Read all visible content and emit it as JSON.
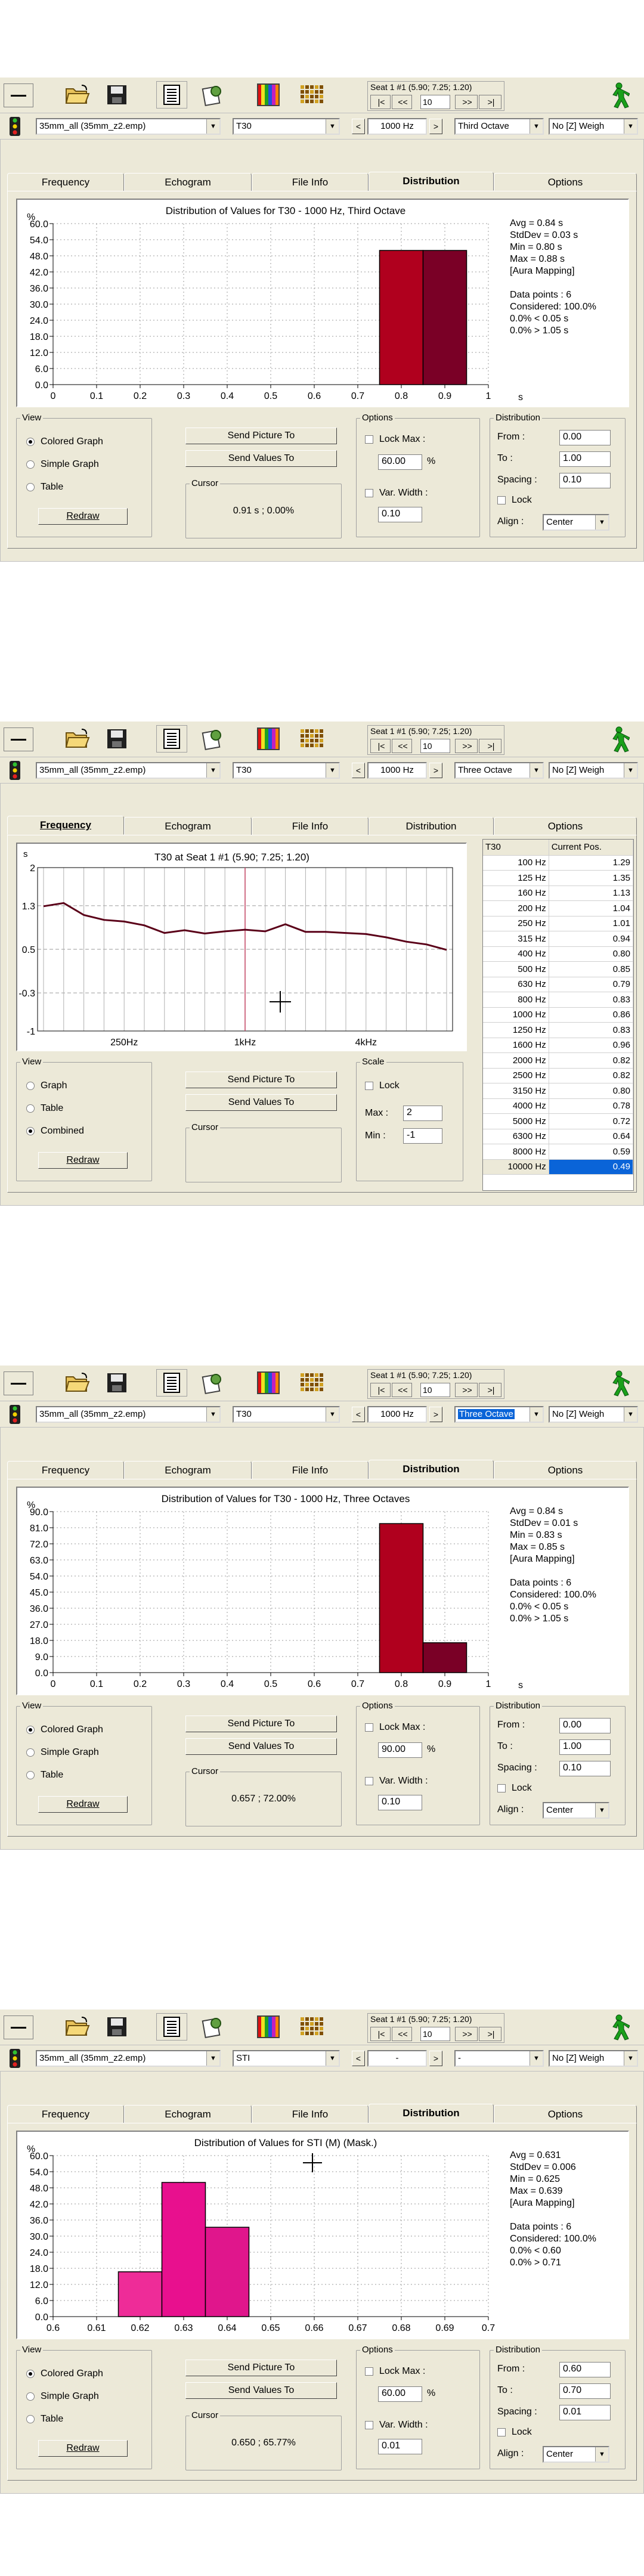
{
  "toolbar": {
    "seat_label": "Seat 1 #1",
    "seat_coords": "(5.90; 7.25; 1.20)",
    "nav_first": "|<",
    "nav_prev": "<<",
    "nav_prev_one": "<",
    "nav_value": "10",
    "nav_next": ">>",
    "nav_last": ">|"
  },
  "tab_labels": [
    "Frequency",
    "Echogram",
    "File Info",
    "Distribution",
    "Options"
  ],
  "common": {
    "view_title": "View",
    "send_picture": "Send Picture To",
    "send_values": "Send Values To",
    "cursor_title": "Cursor",
    "options_title": "Options",
    "distribution_title": "Distribution",
    "lock_max": "Lock Max :",
    "var_width": "Var. Width :",
    "from": "From :",
    "to": "To :",
    "spacing": "Spacing :",
    "lock": "Lock",
    "align": "Align :",
    "redraw": "Redraw",
    "colored_graph": "Colored Graph",
    "simple_graph": "Simple Graph",
    "table": "Table",
    "graph": "Graph",
    "combined": "Combined",
    "scale_title": "Scale",
    "max": "Max :",
    "min": "Min :",
    "percent": "%",
    "unit_s": "s"
  },
  "panels": [
    {
      "file": "35mm_all (35mm_z2.emp)",
      "param": "T30",
      "freq": "1000 Hz",
      "band": "Third Octave",
      "weight": "No [Z] Weigh",
      "active_tab": "Distribution",
      "title": "Distribution of Values for T30 - 1000 Hz, Third Octave",
      "y_ticks": [
        "60.0",
        "54.0",
        "48.0",
        "42.0",
        "36.0",
        "30.0",
        "24.0",
        "18.0",
        "12.0",
        "6.0",
        "0.0"
      ],
      "x_ticks": [
        "0",
        "0.1",
        "0.2",
        "0.3",
        "0.4",
        "0.5",
        "0.6",
        "0.7",
        "0.8",
        "0.9",
        "1"
      ],
      "stats": [
        "Avg = 0.84 s",
        "StdDev = 0.03 s",
        "Min = 0.80 s",
        "Max = 0.88 s",
        "[Aura Mapping]",
        "",
        "Data points : 6",
        "Considered: 100.0%",
        "0.0% < 0.05 s",
        "0.0% > 1.05 s"
      ],
      "cursor_value": "0.91 s ; 0.00%",
      "lock_max_value": "60.00",
      "var_width_value": "0.10",
      "from_value": "0.00",
      "to_value": "1.00",
      "spacing_value": "0.10",
      "align_value": "Center",
      "view_selected": "Colored Graph",
      "chart_data": {
        "type": "bar",
        "title": "Distribution of Values for T30 - 1000 Hz, Third Octave",
        "xlabel": "s",
        "ylabel": "%",
        "ylim": [
          0,
          60
        ],
        "xlim": [
          0,
          1
        ],
        "bin_width": 0.1,
        "bins": [
          {
            "x": 0.8,
            "value": 50.0,
            "color": "#B0001E"
          },
          {
            "x": 0.9,
            "value": 50.0,
            "color": "#7A0026"
          }
        ],
        "grid": true
      }
    },
    {
      "file": "35mm_all (35mm_z2.emp)",
      "param": "T30",
      "freq": "1000 Hz",
      "band": "Three Octave",
      "weight": "No [Z] Weigh",
      "active_tab": "Frequency",
      "title": "T30 at Seat 1 #1 (5.90; 7.25; 1.20)",
      "y_ticks": [
        "2",
        "1.3",
        "0.5",
        "-0.3",
        "-1"
      ],
      "y_unit": "s",
      "x_ticks": [
        "250Hz",
        "1kHz",
        "4kHz"
      ],
      "scale_lock": "Lock",
      "max_value": "2",
      "min_value": "-1",
      "view_selected": "Combined",
      "table_headers": [
        "T30",
        "Current Pos."
      ],
      "table_rows": [
        [
          "100 Hz",
          "1.29"
        ],
        [
          "125 Hz",
          "1.35"
        ],
        [
          "160 Hz",
          "1.13"
        ],
        [
          "200 Hz",
          "1.04"
        ],
        [
          "250 Hz",
          "1.01"
        ],
        [
          "315 Hz",
          "0.94"
        ],
        [
          "400 Hz",
          "0.80"
        ],
        [
          "500 Hz",
          "0.85"
        ],
        [
          "630 Hz",
          "0.79"
        ],
        [
          "800 Hz",
          "0.83"
        ],
        [
          "1000 Hz",
          "0.86"
        ],
        [
          "1250 Hz",
          "0.83"
        ],
        [
          "1600 Hz",
          "0.96"
        ],
        [
          "2000 Hz",
          "0.82"
        ],
        [
          "2500 Hz",
          "0.82"
        ],
        [
          "3150 Hz",
          "0.80"
        ],
        [
          "4000 Hz",
          "0.78"
        ],
        [
          "5000 Hz",
          "0.72"
        ],
        [
          "6300 Hz",
          "0.64"
        ],
        [
          "8000 Hz",
          "0.59"
        ],
        [
          "10000 Hz",
          "0.49"
        ]
      ],
      "chart_data": {
        "type": "line",
        "title": "T30 at Seat 1 #1 (5.90; 7.25; 1.20)",
        "ylabel": "s",
        "ylim": [
          -1,
          2
        ],
        "x": [
          "100 Hz",
          "125 Hz",
          "160 Hz",
          "200 Hz",
          "250 Hz",
          "315 Hz",
          "400 Hz",
          "500 Hz",
          "630 Hz",
          "800 Hz",
          "1000 Hz",
          "1250 Hz",
          "1600 Hz",
          "2000 Hz",
          "2500 Hz",
          "3150 Hz",
          "4000 Hz",
          "5000 Hz",
          "6300 Hz",
          "8000 Hz",
          "10000 Hz"
        ],
        "series": [
          {
            "values": [
              1.29,
              1.35,
              1.13,
              1.04,
              1.01,
              0.94,
              0.8,
              0.85,
              0.79,
              0.83,
              0.86,
              0.83,
              0.96,
              0.82,
              0.82,
              0.8,
              0.78,
              0.72,
              0.64,
              0.59,
              0.49
            ]
          }
        ],
        "grid": true
      }
    },
    {
      "file": "35mm_all (35mm_z2.emp)",
      "param": "T30",
      "freq": "1000 Hz",
      "band": "Three Octave",
      "weight": "No [Z] Weigh",
      "active_tab": "Distribution",
      "title": "Distribution of Values for T30 - 1000 Hz, Three Octaves",
      "y_ticks": [
        "90.0",
        "81.0",
        "72.0",
        "63.0",
        "54.0",
        "45.0",
        "36.0",
        "27.0",
        "18.0",
        "9.0",
        "0.0"
      ],
      "x_ticks": [
        "0",
        "0.1",
        "0.2",
        "0.3",
        "0.4",
        "0.5",
        "0.6",
        "0.7",
        "0.8",
        "0.9",
        "1"
      ],
      "stats": [
        "Avg = 0.84 s",
        "StdDev = 0.01 s",
        "Min = 0.83 s",
        "Max = 0.85 s",
        "[Aura Mapping]",
        "",
        "Data points : 6",
        "Considered: 100.0%",
        "0.0% < 0.05 s",
        "0.0% > 1.05 s"
      ],
      "cursor_value": "0.657 ; 72.00%",
      "lock_max_value": "90.00",
      "var_width_value": "0.10",
      "from_value": "0.00",
      "to_value": "1.00",
      "spacing_value": "0.10",
      "align_value": "Center",
      "view_selected": "Colored Graph",
      "chart_data": {
        "type": "bar",
        "title": "Distribution of Values for T30 - 1000 Hz, Three Octaves",
        "xlabel": "s",
        "ylabel": "%",
        "ylim": [
          0,
          90
        ],
        "xlim": [
          0,
          1
        ],
        "bin_width": 0.1,
        "bins": [
          {
            "x": 0.8,
            "value": 83.3,
            "color": "#B0001E"
          },
          {
            "x": 0.9,
            "value": 16.7,
            "color": "#7A0026"
          }
        ],
        "grid": true
      }
    },
    {
      "file": "35mm_all (35mm_z2.emp)",
      "param": "STI",
      "freq": "-",
      "band": "-",
      "weight": "No [Z] Weigh",
      "active_tab": "Distribution",
      "title": "Distribution of Values for STI (M) (Mask.)",
      "y_ticks": [
        "60.0",
        "54.0",
        "48.0",
        "42.0",
        "36.0",
        "30.0",
        "24.0",
        "18.0",
        "12.0",
        "6.0",
        "0.0"
      ],
      "x_ticks": [
        "0.6",
        "0.61",
        "0.62",
        "0.63",
        "0.64",
        "0.65",
        "0.66",
        "0.67",
        "0.68",
        "0.69",
        "0.7"
      ],
      "stats": [
        "Avg = 0.631",
        "StdDev = 0.006",
        "Min = 0.625",
        "Max = 0.639",
        "[Aura Mapping]",
        "",
        "Data points : 6",
        "Considered: 100.0%",
        "0.0% < 0.60",
        "0.0% > 0.71"
      ],
      "cursor_value": "0.650 ; 65.77%",
      "lock_max_value": "60.00",
      "var_width_value": "0.01",
      "from_value": "0.60",
      "to_value": "0.70",
      "spacing_value": "0.01",
      "align_value": "Center",
      "view_selected": "Colored Graph",
      "chart_data": {
        "type": "bar",
        "title": "Distribution of Values for STI (M) (Mask.)",
        "ylabel": "%",
        "ylim": [
          0,
          60
        ],
        "xlim": [
          0.6,
          0.7
        ],
        "bin_width": 0.01,
        "bins": [
          {
            "x": 0.62,
            "value": 16.7,
            "color": "#EE2C98"
          },
          {
            "x": 0.63,
            "value": 50.0,
            "color": "#E8108E"
          },
          {
            "x": 0.64,
            "value": 33.3,
            "color": "#E0168C"
          }
        ],
        "grid": true
      }
    }
  ],
  "colors": {
    "window_bg": "#ECE9D8",
    "highlight": "#0A64D8",
    "curve": "#5A0018",
    "cursor_line": "#C04060",
    "grid": "#9A9A9A"
  },
  "icons": [
    "minimize-icon",
    "folder-open-icon",
    "save-icon",
    "notes-icon",
    "settings-icon",
    "color-map-icon",
    "grid-map-icon",
    "walking-man-icon",
    "traffic-light-icon"
  ]
}
